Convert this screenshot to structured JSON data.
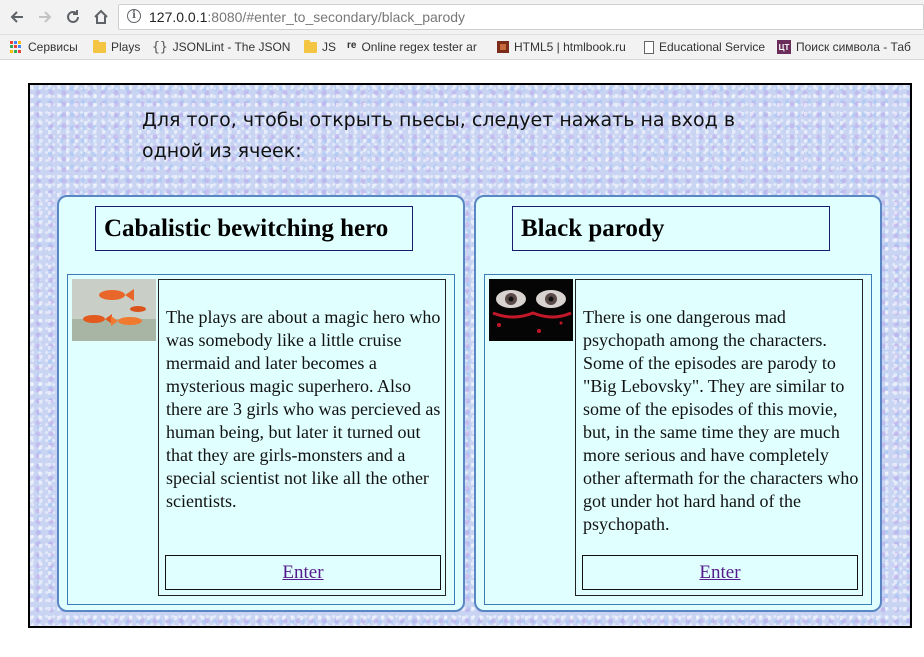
{
  "browser": {
    "url_host": "127.0.0.1",
    "url_rest": ":8080/#enter_to_secondary/black_parody",
    "bookmarks": [
      {
        "label": "Сервисы",
        "icon": "apps-icon"
      },
      {
        "label": "Plays",
        "icon": "folder-icon"
      },
      {
        "label": "JSONLint - The JSON",
        "icon": "json-icon"
      },
      {
        "label": "JS",
        "icon": "folder-icon"
      },
      {
        "label": "Online regex tester ar",
        "icon": "regex-icon"
      },
      {
        "label": "HTML5 | htmlbook.ru",
        "icon": "html5-icon"
      },
      {
        "label": "Educational Service",
        "icon": "doc-icon"
      },
      {
        "label": "Поиск символа - Таб",
        "icon": "unicode-table-icon"
      }
    ]
  },
  "page": {
    "intro": "Для того, чтобы открыть пьесы, следует нажать на вход в одной из ячеек:",
    "cards": [
      {
        "title": "Cabalistic bewitching hero",
        "image": "goldfish-image",
        "description": "The plays are about a magic hero who was somebody like a little cruise mermaid and later becomes a mysterious magic superhero. Also there are 3 girls who was percieved as human being, but later it turned out that they are girls-monsters and a special scientist not like all the other scientists.",
        "enter_label": "Enter"
      },
      {
        "title": "Black parody",
        "image": "eyes-image",
        "description": "There is one dangerous mad psychopath among the characters. Some of the episodes are parody to \"Big Lebovsky\". They are similar to some of the episodes of this movie, but, in the same time they are much more serious and have completely other aftermath for the characters who got under hot hard hand of the psychopath.",
        "enter_label": "Enter"
      }
    ]
  },
  "colors": {
    "card_background": "#e0ffff",
    "card_border": "#5a86c4",
    "link": "#551a8b"
  }
}
